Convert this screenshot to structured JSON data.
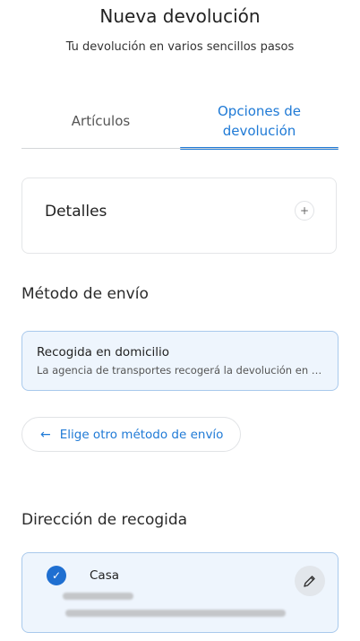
{
  "header": {
    "title": "Nueva devolución",
    "subtitle": "Tu devolución en varios sencillos pasos"
  },
  "tabs": [
    {
      "label": "Artículos",
      "active": false
    },
    {
      "label": "Opciones de devolución",
      "active": true
    }
  ],
  "details": {
    "label": "Detalles",
    "plus": "+"
  },
  "shipping": {
    "section_title": "Método de envío",
    "selected_title": "Recogida en domicilio",
    "selected_desc": "La agencia de transportes recogerá la devolución en la…",
    "change_label": "Elige otro método de envío",
    "arrow": "←"
  },
  "pickup": {
    "section_title": "Dirección de recogida",
    "address_name": "Casa",
    "check": "✓"
  },
  "colors": {
    "accent": "#1f7ad6",
    "selected_bg": "#eef5fd",
    "selected_border": "#a9c9ec"
  }
}
